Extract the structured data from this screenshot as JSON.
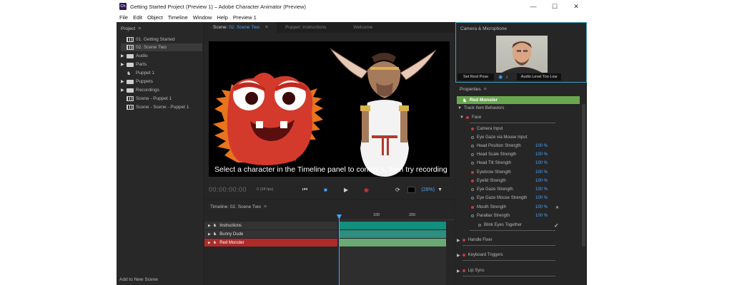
{
  "window": {
    "app_icon_text": "Ch",
    "title": "Getting Started Project (Preview 1) – Adobe Character Animator (Preview)",
    "minimize": "—",
    "maximize": "☐",
    "close": "✕"
  },
  "menubar": [
    "File",
    "Edit",
    "Object",
    "Timeline",
    "Window",
    "Help",
    "Preview 1"
  ],
  "project": {
    "title": "Project",
    "menu_glyph": "≡",
    "items": [
      {
        "label": "01. Getting Started",
        "type": "scene",
        "expandable": false
      },
      {
        "label": "02. Scene Two",
        "type": "scene",
        "expandable": false,
        "selected": true
      },
      {
        "label": "Audio",
        "type": "folder",
        "expandable": true
      },
      {
        "label": "Parts",
        "type": "folder",
        "expandable": true
      },
      {
        "label": "Puppet 1",
        "type": "puppet",
        "expandable": false
      },
      {
        "label": "Puppets",
        "type": "folder",
        "expandable": true
      },
      {
        "label": "Recordings",
        "type": "folder",
        "expandable": true
      },
      {
        "label": "Scene - Puppet 1",
        "type": "scene",
        "expandable": false
      },
      {
        "label": "Scene - Scene - Puppet 1",
        "type": "scene",
        "expandable": false
      }
    ],
    "add_to_scene": "Add to New Scene"
  },
  "scene_panel": {
    "tabs": [
      {
        "prefix": "Scene:",
        "label": "02. Scene Two",
        "active": true
      },
      {
        "prefix": "",
        "label": "Puppet: Instructions",
        "active": false
      },
      {
        "prefix": "",
        "label": "Welcome",
        "active": false
      }
    ],
    "menu_glyph": "≡",
    "caption": "Select a character in the Timeline panel to control it, then try recording",
    "timecode": "00:00:00:00",
    "fps": "0 (24 fps)",
    "zoom": "(28%)",
    "zoom_caret": "▼"
  },
  "timeline": {
    "title": "Timeline: 02. Scene Two",
    "menu_glyph": "≡",
    "ruler_ticks": [
      "100",
      "200"
    ],
    "tracks": [
      {
        "name": "Instructions",
        "selected": false,
        "color": "#138f7e"
      },
      {
        "name": "Bunny Dude",
        "selected": false,
        "color": "#2d8f7f"
      },
      {
        "name": "Red Monster",
        "selected": true,
        "color": "#6aa874"
      }
    ]
  },
  "camera": {
    "title": "Camera & Microphone",
    "set_rest_pose": "Set Rest Pose",
    "audio_label": "Audio Level Too Low"
  },
  "properties": {
    "title": "Properties",
    "menu_glyph": "≡",
    "puppet_name": "Red Monster",
    "section": "Track Item Behaviors",
    "face": "Face",
    "rows": [
      {
        "label": "Camera Input",
        "dot": "red",
        "value": ""
      },
      {
        "label": "Eye Gaze via Mouse Input",
        "dot": "open",
        "value": ""
      },
      {
        "label": "Head Position Strength",
        "dot": "open",
        "value": "100 %"
      },
      {
        "label": "Head Scale Strength",
        "dot": "open",
        "value": "100 %"
      },
      {
        "label": "Head Tilt Strength",
        "dot": "open",
        "value": "100 %"
      },
      {
        "label": "Eyebrow Strength",
        "dot": "red",
        "value": "100 %"
      },
      {
        "label": "Eyelid Strength",
        "dot": "red",
        "value": "100 %"
      },
      {
        "label": "Eye Gaze Strength",
        "dot": "open",
        "value": "100 %"
      },
      {
        "label": "Eye Gaze Mouse Strength",
        "dot": "open",
        "value": "100 %"
      },
      {
        "label": "Mouth Strength",
        "dot": "red",
        "value": "100 %"
      },
      {
        "label": "Parallax Strength",
        "dot": "open",
        "value": "100 %"
      }
    ],
    "blink": "Blink Eyes Together",
    "check": "✓",
    "groups": [
      "Handle Fixer",
      "Keyboard Triggers",
      "Lip Sync"
    ]
  }
}
